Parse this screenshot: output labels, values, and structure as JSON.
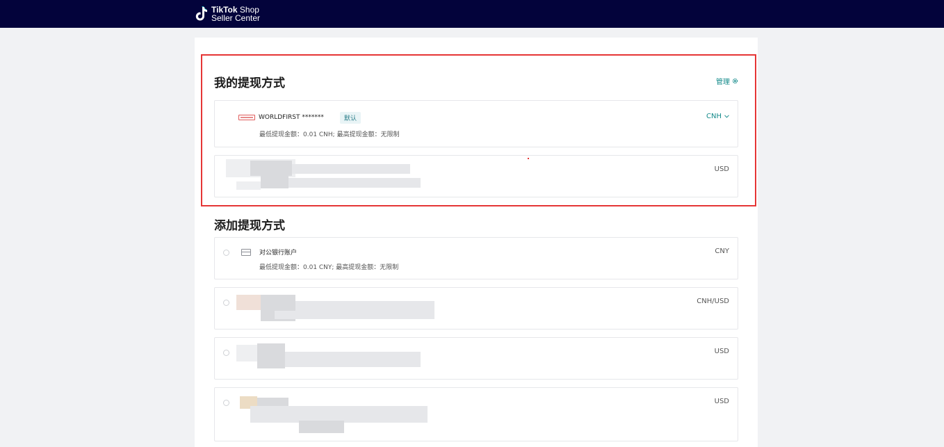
{
  "header": {
    "brand_line1_bold": "TikTok",
    "brand_line1_rest": " Shop",
    "brand_line2": "Seller Center"
  },
  "my_methods": {
    "title": "我的提现方式",
    "manage_label": "管理",
    "items": [
      {
        "name": "WORLDFIRST *******",
        "badge": "默认",
        "limits": "最低提现金额：0.01 CNH; 最高提现金额：无限制",
        "currency": "CNH"
      },
      {
        "currency": "USD"
      }
    ]
  },
  "add_methods": {
    "title": "添加提现方式",
    "items": [
      {
        "name": "对公银行账户",
        "limits": "最低提现金额：0.01 CNY; 最高提现金额：无限制",
        "currency": "CNY"
      },
      {
        "currency": "CNH/USD"
      },
      {
        "currency": "USD"
      },
      {
        "currency": "USD"
      }
    ]
  },
  "colors": {
    "header_bg": "#03033b",
    "accent": "#138a8a",
    "highlight_border": "#e53535"
  },
  "icons": [
    "tiktok-logo-icon",
    "gear-icon",
    "chevron-down-icon",
    "worldfirst-logo-icon",
    "bank-card-icon"
  ]
}
